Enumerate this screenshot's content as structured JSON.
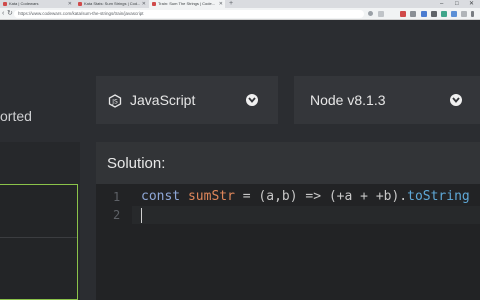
{
  "browser": {
    "tabs": [
      {
        "label": "Kata | Codewars",
        "active": false
      },
      {
        "label": "Kata Stats: Sum Strings | Cod...",
        "active": false
      },
      {
        "label": "Train: Sum The Strings | Code...",
        "active": true
      }
    ],
    "new_tab": "+",
    "url": "https://www.codewars.com/kata/sum-the-strings/train/javascript",
    "window_controls": [
      "–",
      "□",
      "✕"
    ]
  },
  "header": {
    "sorted_text": "orted",
    "language_label": "JavaScript",
    "runtime_label": "Node v8.1.3"
  },
  "solution": {
    "title": "Solution:",
    "line_numbers": [
      "1",
      "2"
    ],
    "code": {
      "kw": "const ",
      "fn": "sumStr",
      "p1": " = (a,b) => (+a + +b).",
      "method": "toString"
    }
  },
  "colors": {
    "accent_green": "#8bc34a",
    "background": "#2b2d31",
    "editor_bg": "#222325"
  },
  "icons": {
    "language": "nodejs-hexagon-icon",
    "dropdown": "chevron-down-icon"
  }
}
